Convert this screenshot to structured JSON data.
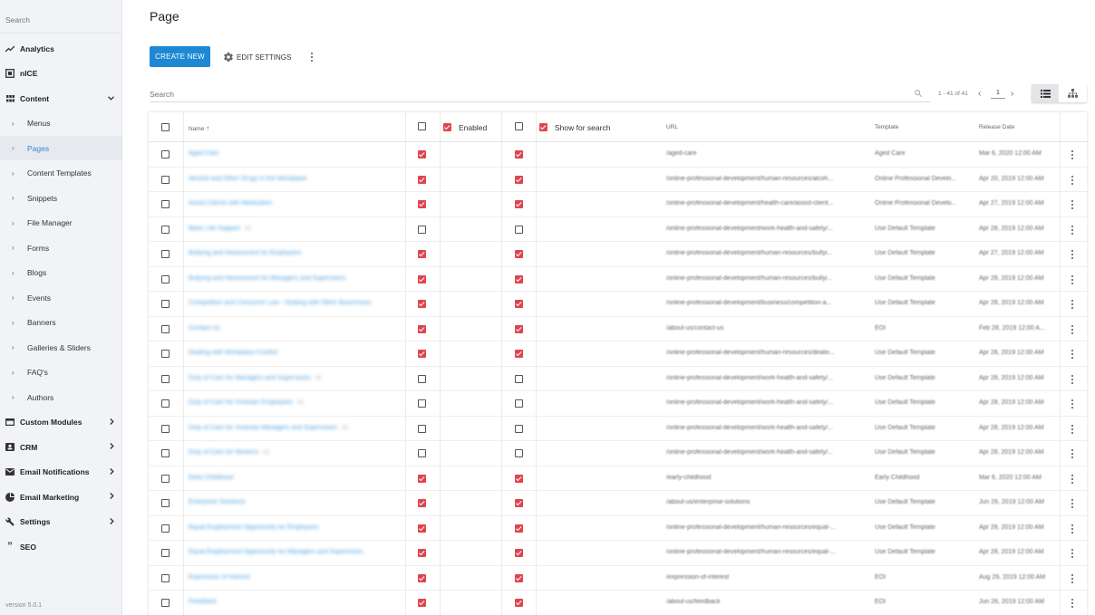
{
  "sidebar": {
    "search_placeholder": "Search",
    "version": "version 5.0.1",
    "items": [
      {
        "label": "Analytics",
        "icon": "trending-up-icon",
        "type": "top"
      },
      {
        "label": "nICE",
        "icon": "nice-logo-icon",
        "type": "top"
      },
      {
        "label": "Content",
        "icon": "grid-icon",
        "type": "top",
        "expanded": true
      },
      {
        "label": "Menus",
        "type": "sub"
      },
      {
        "label": "Pages",
        "type": "sub",
        "active": true
      },
      {
        "label": "Content Templates",
        "type": "sub"
      },
      {
        "label": "Snippets",
        "type": "sub"
      },
      {
        "label": "File Manager",
        "type": "sub"
      },
      {
        "label": "Forms",
        "type": "sub"
      },
      {
        "label": "Blogs",
        "type": "sub"
      },
      {
        "label": "Events",
        "type": "sub"
      },
      {
        "label": "Banners",
        "type": "sub"
      },
      {
        "label": "Galleries & Sliders",
        "type": "sub"
      },
      {
        "label": "FAQ's",
        "type": "sub"
      },
      {
        "label": "Authors",
        "type": "sub"
      },
      {
        "label": "Custom Modules",
        "icon": "window-icon",
        "type": "top",
        "collapsed": true
      },
      {
        "label": "CRM",
        "icon": "contact-card-icon",
        "type": "top",
        "collapsed": true
      },
      {
        "label": "Email Notifications",
        "icon": "mail-icon",
        "type": "top",
        "collapsed": true
      },
      {
        "label": "Email Marketing",
        "icon": "pie-chart-icon",
        "type": "top",
        "collapsed": true
      },
      {
        "label": "Settings",
        "icon": "wrench-icon",
        "type": "top",
        "collapsed": true
      },
      {
        "label": "SEO",
        "icon": "quote-icon",
        "type": "top"
      }
    ]
  },
  "header": {
    "title": "Page",
    "create_label": "CREATE NEW",
    "edit_label": "EDIT SETTINGS"
  },
  "search": {
    "placeholder": "Search"
  },
  "pager": {
    "range": "1 - 41 of 41",
    "page": "1"
  },
  "colors": {
    "accent": "#1e88d4",
    "checkbox_on": "#e0454f",
    "active_link": "#2d8fd6"
  },
  "table": {
    "headers": {
      "name": "Name",
      "enabled": "Enabled",
      "show_for_search": "Show for search",
      "url": "URL",
      "template": "Template",
      "release_date": "Release Date"
    },
    "rows": [
      {
        "name": "Aged Care",
        "ver": "",
        "enabled": true,
        "search": true,
        "url": "/aged-care",
        "template": "Aged Care",
        "date": "Mar 6, 2020 12:00 AM"
      },
      {
        "name": "Alcohol and Other Drugs in the Workplace",
        "ver": "",
        "enabled": true,
        "search": true,
        "url": "/online-professional-development/human-resources/alcoh...",
        "template": "Online Professional Develo...",
        "date": "Apr 20, 2019 12:00 AM"
      },
      {
        "name": "Assist Clients with Medication",
        "ver": "",
        "enabled": true,
        "search": true,
        "url": "/online-professional-development/health-care/assist-client...",
        "template": "Online Professional Develo...",
        "date": "Apr 27, 2019 12:00 AM"
      },
      {
        "name": "Basic Life Support",
        "ver": "1b",
        "enabled": false,
        "search": false,
        "url": "/online-professional-development/work-health-and-safety/...",
        "template": "Use Default Template",
        "date": "Apr 28, 2019 12:00 AM"
      },
      {
        "name": "Bullying and Harassment for Employees",
        "ver": "",
        "enabled": true,
        "search": true,
        "url": "/online-professional-development/human-resources/bullyi...",
        "template": "Use Default Template",
        "date": "Apr 27, 2019 12:00 AM"
      },
      {
        "name": "Bullying and Harassment for Managers and Supervisors",
        "ver": "",
        "enabled": true,
        "search": true,
        "url": "/online-professional-development/human-resources/bullyi...",
        "template": "Use Default Template",
        "date": "Apr 28, 2019 12:00 AM"
      },
      {
        "name": "Competition and Consumer Law - Dealing with Other Businesses",
        "ver": "",
        "enabled": true,
        "search": true,
        "url": "/online-professional-development/business/competition-a...",
        "template": "Use Default Template",
        "date": "Apr 28, 2019 12:00 AM"
      },
      {
        "name": "Contact Us",
        "ver": "",
        "enabled": true,
        "search": true,
        "url": "/about-us/contact-us",
        "template": "EOI",
        "date": "Feb 28, 2019 12:00 A..."
      },
      {
        "name": "Dealing with Workplace Conflict",
        "ver": "",
        "enabled": true,
        "search": true,
        "url": "/online-professional-development/human-resources/dealin...",
        "template": "Use Default Template",
        "date": "Apr 28, 2019 12:00 AM"
      },
      {
        "name": "Duty of Care for Managers and Supervisors",
        "ver": "1b",
        "enabled": false,
        "search": false,
        "url": "/online-professional-development/work-health-and-safety/...",
        "template": "Use Default Template",
        "date": "Apr 28, 2019 12:00 AM"
      },
      {
        "name": "Duty of Care for Victorian Employees",
        "ver": "1b",
        "enabled": false,
        "search": false,
        "url": "/online-professional-development/work-health-and-safety/...",
        "template": "Use Default Template",
        "date": "Apr 28, 2019 12:00 AM"
      },
      {
        "name": "Duty of Care for Victorian Managers and Supervisors",
        "ver": "1b",
        "enabled": false,
        "search": false,
        "url": "/online-professional-development/work-health-and-safety/...",
        "template": "Use Default Template",
        "date": "Apr 28, 2019 12:00 AM"
      },
      {
        "name": "Duty of Care for Workers",
        "ver": "1b",
        "enabled": false,
        "search": false,
        "url": "/online-professional-development/work-health-and-safety/...",
        "template": "Use Default Template",
        "date": "Apr 28, 2019 12:00 AM"
      },
      {
        "name": "Early Childhood",
        "ver": "",
        "enabled": true,
        "search": true,
        "url": "/early-childhood",
        "template": "Early Childhood",
        "date": "Mar 6, 2020 12:00 AM"
      },
      {
        "name": "Enterprise Solutions",
        "ver": "",
        "enabled": true,
        "search": true,
        "url": "/about-us/enterprise-solutions",
        "template": "Use Default Template",
        "date": "Jun 26, 2019 12:00 AM"
      },
      {
        "name": "Equal Employment Opportunity for Employees",
        "ver": "",
        "enabled": true,
        "search": true,
        "url": "/online-professional-development/human-resources/equal-...",
        "template": "Use Default Template",
        "date": "Apr 28, 2019 12:00 AM"
      },
      {
        "name": "Equal Employment Opportunity for Managers and Supervisors",
        "ver": "",
        "enabled": true,
        "search": true,
        "url": "/online-professional-development/human-resources/equal-...",
        "template": "Use Default Template",
        "date": "Apr 28, 2019 12:00 AM"
      },
      {
        "name": "Expression of Interest",
        "ver": "",
        "enabled": true,
        "search": true,
        "url": "/expression-of-interest",
        "template": "EOI",
        "date": "Aug 29, 2019 12:00 AM"
      },
      {
        "name": "Feedback",
        "ver": "",
        "enabled": true,
        "search": true,
        "url": "/about-us/feedback",
        "template": "EOI",
        "date": "Jun 26, 2019 12:00 AM"
      }
    ]
  }
}
